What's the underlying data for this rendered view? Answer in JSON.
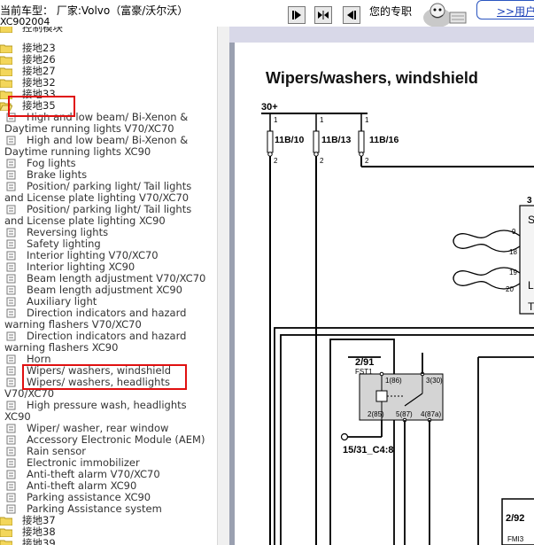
{
  "toolbar": {
    "car_label": "当前车型：  厂家:Volvo（富豪/沃尔沃）",
    "model_code": "XC902004",
    "message_label": "您的专职",
    "user_link": ">>用户"
  },
  "tree": {
    "folders_top": [
      "接地",
      "控制模块",
      "接地23",
      "接地26",
      "接地27",
      "接地32",
      "接地33",
      "接地35"
    ],
    "leaves": [
      "High and low beam/ Bi-Xenon & Daytime running lights V70/XC70",
      "High and low beam/ Bi-Xenon & Daytime running lights XC90",
      "Fog lights",
      "Brake lights",
      "Position/ parking light/ Tail lights and License plate lighting V70/XC70",
      "Position/ parking light/ Tail lights and License plate lighting XC90",
      "Reversing lights",
      "Safety lighting",
      "Interior lighting V70/XC70",
      "Interior lighting XC90",
      "Beam length adjustment V70/XC70",
      "Beam length adjustment XC90",
      "Auxiliary light",
      "Direction indicators and hazard warning flashers V70/XC70",
      "Direction indicators and hazard warning flashers XC90",
      "Horn",
      "Wipers/ washers, windshield",
      "Wipers/ washers, headlights",
      "High pressure wash, headlights XC90",
      "Wiper/ washer, rear window",
      "Accessory Electronic Module (AEM)",
      "Rain sensor",
      "Electronic immobilizer",
      "Anti-theft alarm V70/XC70",
      "Anti-theft alarm XC90",
      "Parking assistance XC90",
      "Parking Assistance system"
    ],
    "folders_bottom": [
      "接地37",
      "接地38",
      "接地39"
    ]
  },
  "diagram": {
    "title": "Wipers/washers, windshield",
    "supply": "30+",
    "fuses": [
      "11B/10",
      "11B/13",
      "11B/16"
    ],
    "pin_top": "1",
    "pin_bottom": "2",
    "wire_pins": [
      "9",
      "18",
      "19",
      "20"
    ],
    "relay_label": "2/91",
    "relay_sub": "FST1",
    "relay_pins": [
      "1(86)",
      "3(30)",
      "2(85)",
      "5(87)",
      "4(87a)"
    ],
    "ground_label": "15/31_C4:8",
    "module_label": "2/92",
    "module_sub": "FMI3",
    "edge_marks": [
      "3",
      "S",
      "L",
      "T"
    ]
  }
}
